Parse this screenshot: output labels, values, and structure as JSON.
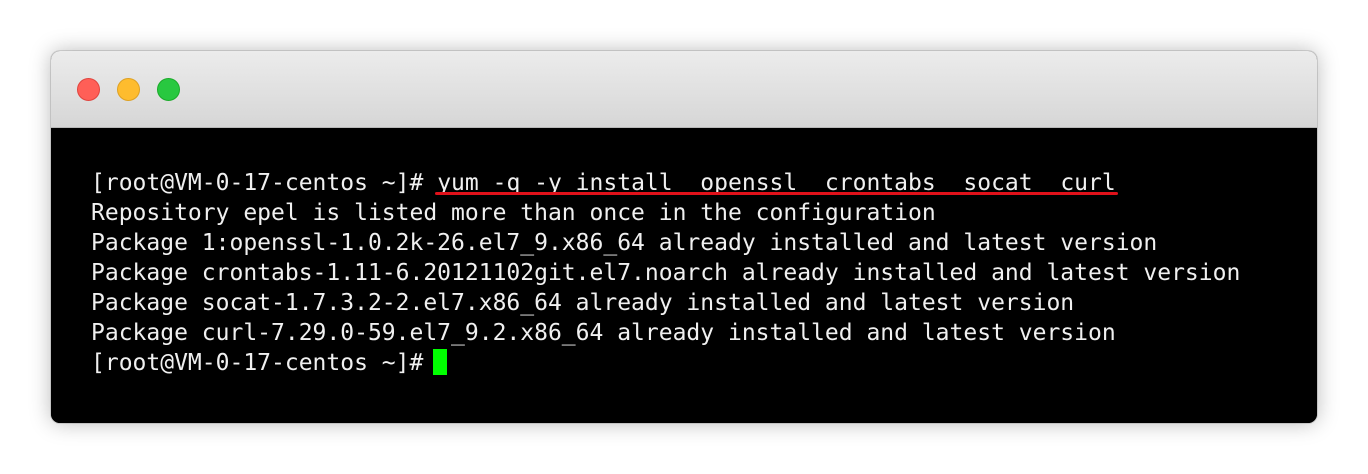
{
  "window": {
    "controls": [
      "close",
      "minimize",
      "zoom"
    ]
  },
  "terminal": {
    "prompt": "[root@VM-0-17-centos ~]#",
    "command": "yum -q -y install  openssl  crontabs  socat  curl",
    "output": [
      "Repository epel is listed more than once in the configuration",
      "Package 1:openssl-1.0.2k-26.el7_9.x86_64 already installed and latest version",
      "Package crontabs-1.11-6.20121102git.el7.noarch already installed and latest version",
      "Package socat-1.7.3.2-2.el7.x86_64 already installed and latest version",
      "Package curl-7.29.0-59.el7_9.2.x86_64 already installed and latest version"
    ],
    "final_prompt": "[root@VM-0-17-centos ~]#"
  },
  "colors": {
    "background": "#000000",
    "text": "#f0f0f0",
    "cursor": "#00ff00",
    "highlight_underline": "#e0111a"
  }
}
